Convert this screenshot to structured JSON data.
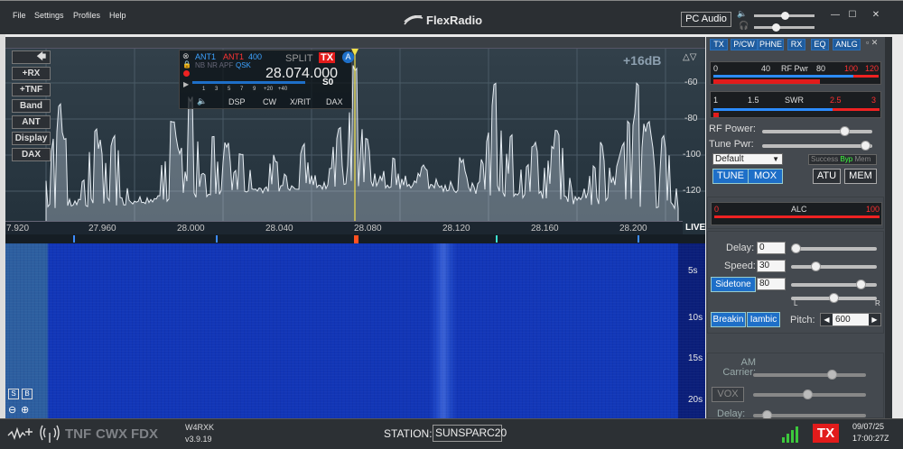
{
  "menu": [
    "File",
    "Settings",
    "Profiles",
    "Help"
  ],
  "app": {
    "title": "FlexRadio"
  },
  "audio": {
    "label": "PC Audio"
  },
  "window_buttons": [
    "—",
    "☐",
    "✕"
  ],
  "pan_controls": {
    "buttons": [
      "+RX",
      "+TNF",
      "Band",
      "ANT",
      "Display",
      "DAX"
    ],
    "db_offset": "+16dB"
  },
  "vfo": {
    "antennas": [
      "ANT1",
      "ANT1",
      "400"
    ],
    "nb": "NB NR APF",
    "qsk": "QSK",
    "split": "SPLIT",
    "tx_badge": "TX",
    "slice": "A",
    "frequency": "28.074.000",
    "smeter": "S0",
    "scale": [
      "1",
      "3",
      "5",
      "7",
      "9",
      "+20",
      "+40"
    ],
    "tabs": [
      "DSP",
      "CW",
      "X/RIT",
      "DAX"
    ]
  },
  "db_scale": [
    "-60",
    "-80",
    "-100",
    "-120"
  ],
  "freq_axis": [
    "7.920",
    "27.960",
    "28.000",
    "28.040",
    "28.080",
    "28.120",
    "28.160",
    "28.200"
  ],
  "live": "LIVE",
  "wf_times": [
    "5s",
    "10s",
    "15s",
    "20s"
  ],
  "right_tabs": [
    "TX",
    "P/CW",
    "PHNE",
    "RX",
    "EQ",
    "ANLG"
  ],
  "meters": {
    "rfpwr": {
      "name": "RF Pwr",
      "scale": [
        "0",
        "40",
        "80",
        "100",
        "120"
      ]
    },
    "swr": {
      "name": "SWR",
      "scale": [
        "1",
        "1.5",
        "2.5",
        "3"
      ]
    },
    "alc": {
      "name": "ALC",
      "left": "0",
      "right": "100"
    }
  },
  "tx": {
    "rf_power_label": "RF Power:",
    "tune_pwr_label": "Tune Pwr:",
    "rf_power": 0.78,
    "tune_power": 0.99,
    "profile": "Default",
    "status": [
      "Success",
      "Byp",
      "Mem"
    ],
    "tune": "TUNE",
    "mox": "MOX",
    "atu": "ATU",
    "mem": "MEM"
  },
  "cw": {
    "delay_label": "Delay:",
    "delay": "0",
    "speed_label": "Speed:",
    "speed": "30",
    "sidetone": "Sidetone",
    "sidetone_val": "80",
    "pan_l": "L",
    "pan_r": "R",
    "breakin": "Breakin",
    "iambic": "Iambic",
    "pitch_label": "Pitch:",
    "pitch": "600"
  },
  "phone": {
    "am_carrier_label": "AM Carrier:",
    "vox": "VOX",
    "delay_label": "Delay:"
  },
  "status": {
    "modes": [
      "TNF",
      "CWX",
      "FDX"
    ],
    "callsign": "W4RXK",
    "version": "v3.9.19",
    "station_label": "STATION:",
    "station": "SUNSPARC20",
    "tx": "TX",
    "date": "09/07/25",
    "time": "17:00:27Z"
  },
  "sb_buttons": [
    "S",
    "B"
  ],
  "colors": {
    "accent": "#1e6fc8",
    "tx_red": "#e21b1b",
    "trace": "#dfe6ee",
    "waterfall": "#1236b6"
  }
}
